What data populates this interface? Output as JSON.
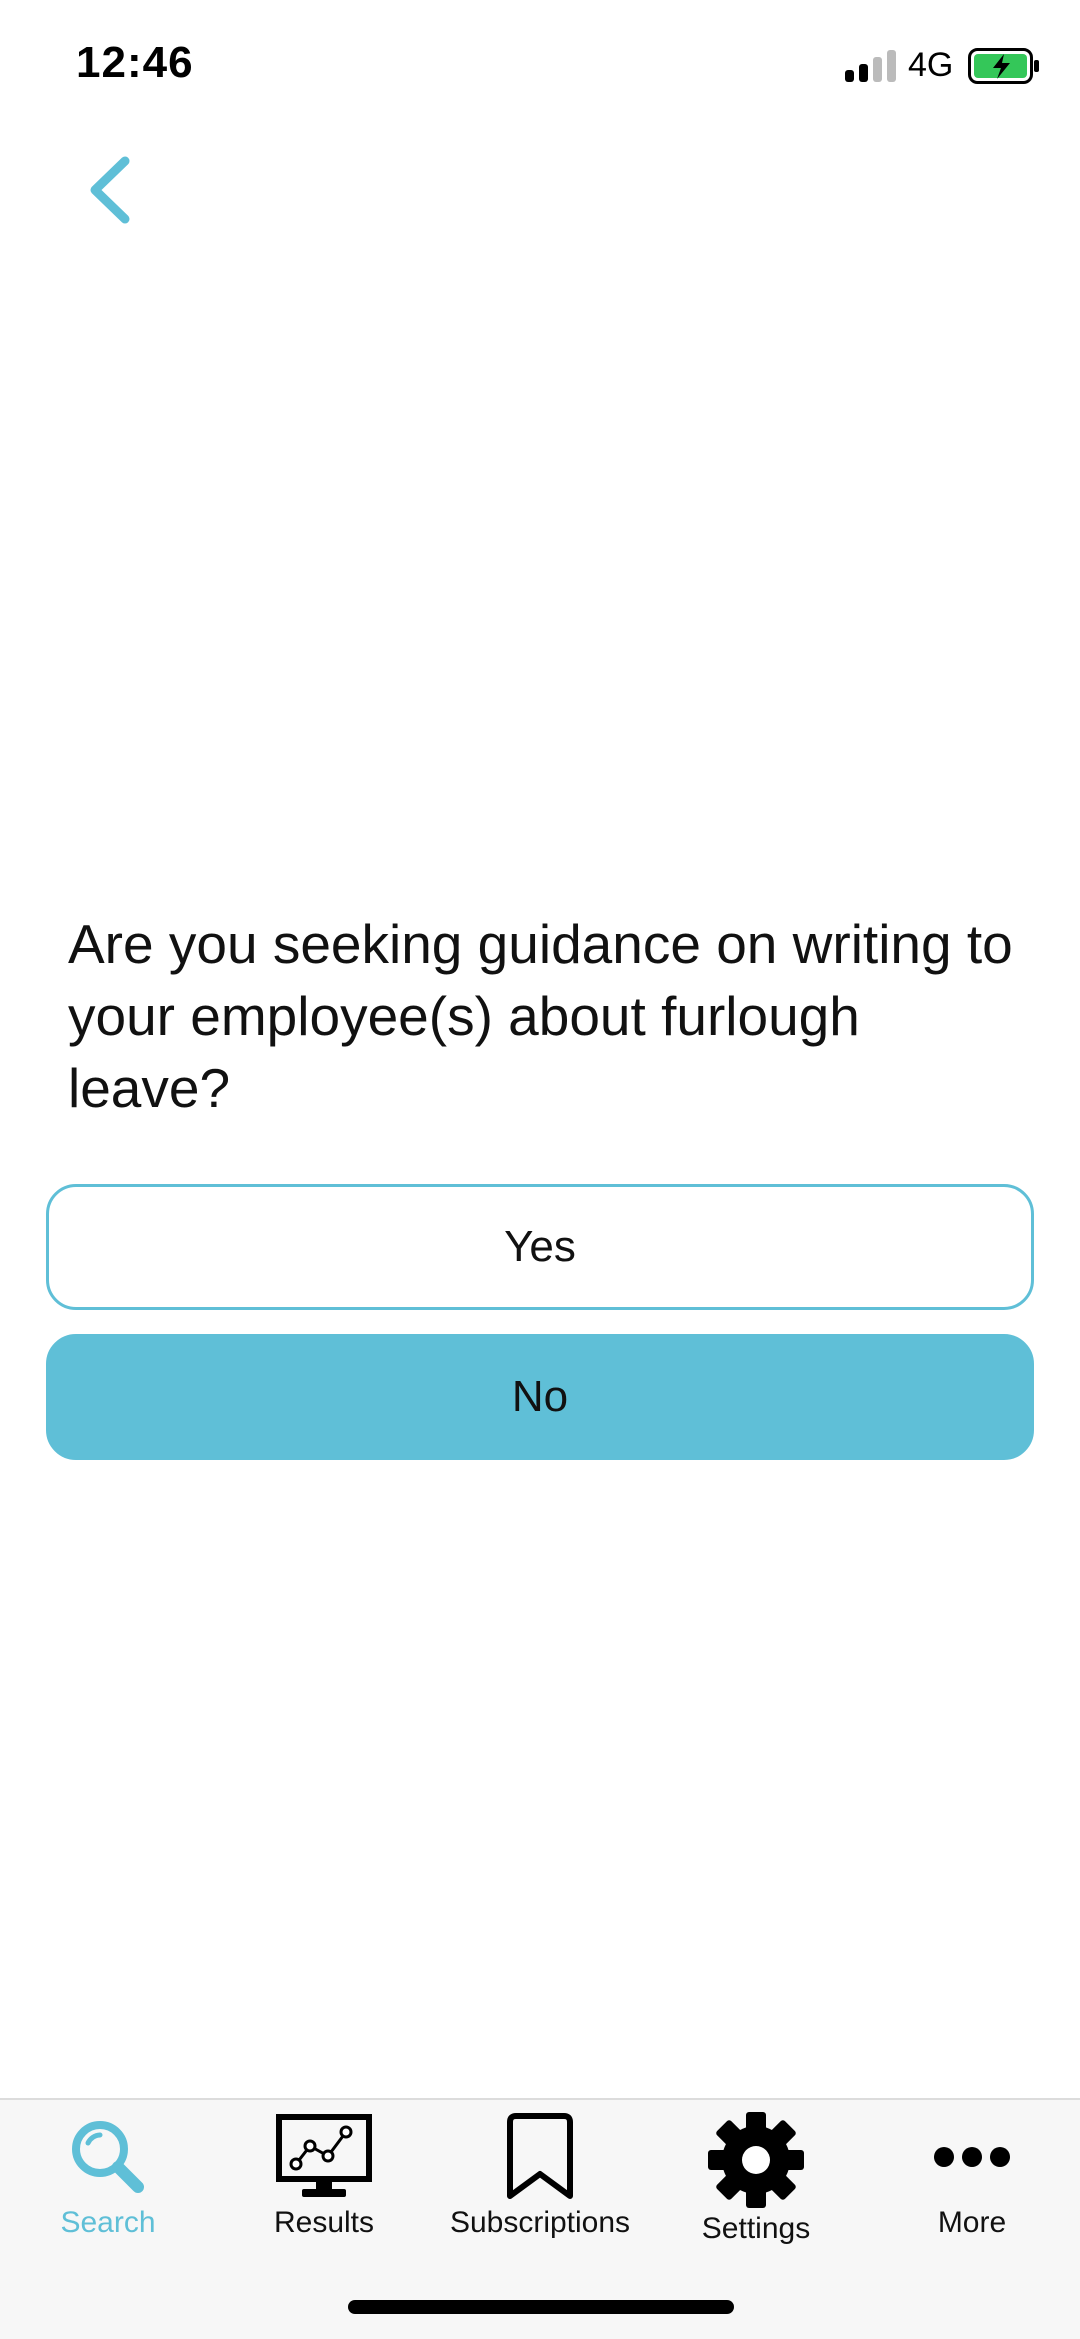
{
  "status_bar": {
    "time": "12:46",
    "network": "4G"
  },
  "question": {
    "text": "Are you seeking guidance on writing to your employee(s) about furlough leave?"
  },
  "answers": {
    "yes_label": "Yes",
    "no_label": "No"
  },
  "tab_bar": {
    "items": [
      {
        "label": "Search",
        "icon": "search-icon",
        "active": true
      },
      {
        "label": "Results",
        "icon": "monitor-chart-icon",
        "active": false
      },
      {
        "label": "Subscriptions",
        "icon": "bookmark-icon",
        "active": false
      },
      {
        "label": "Settings",
        "icon": "gear-icon",
        "active": false
      },
      {
        "label": "More",
        "icon": "more-dots-icon",
        "active": false
      }
    ]
  },
  "colors": {
    "accent": "#5fbfd7",
    "battery_fill": "#34c759",
    "text": "#111111",
    "tab_bar_bg": "#f7f7f7"
  }
}
